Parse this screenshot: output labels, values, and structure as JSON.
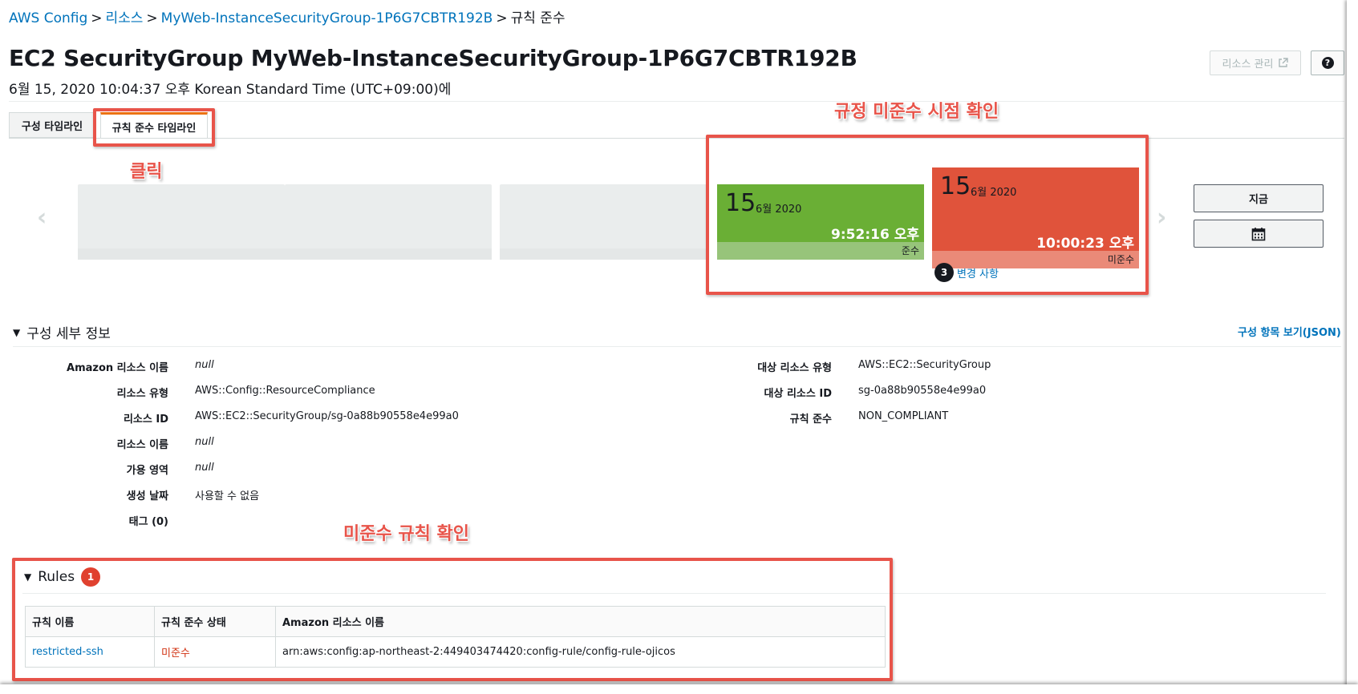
{
  "breadcrumb": {
    "items": [
      "AWS Config",
      "리소스",
      "MyWeb-InstanceSecurityGroup-1P6G7CBTR192B"
    ],
    "current": "규칙 준수",
    "separator": ">"
  },
  "header": {
    "title": "EC2 SecurityGroup MyWeb-InstanceSecurityGroup-1P6G7CBTR192B",
    "subtitle": "6월 15, 2020 10:04:37 오후 Korean Standard Time (UTC+09:00)에",
    "manage_button": "리소스 관리",
    "help_button": "?"
  },
  "tabs": [
    {
      "label": "구성 타임라인"
    },
    {
      "label": "규칙 준수 타임라인"
    }
  ],
  "annotations": {
    "click": "클릭",
    "timeline": "규정 미준수 시점 확인",
    "rules": "미준수 규칙 확인"
  },
  "timeline": {
    "cards": [
      {
        "day": "15",
        "month": "6월 2020",
        "time": "9:52:16 오후",
        "status": "준수",
        "color": "#6aaf35"
      },
      {
        "day": "15",
        "month": "6월 2020",
        "time": "10:00:23 오후",
        "status": "미준수",
        "color": "#e0533b"
      }
    ],
    "changes_count": "3",
    "changes_label": "변경 사항",
    "now_button": "지금",
    "calendar_icon": "calendar-icon"
  },
  "config_details": {
    "title": "구성 세부 정보",
    "json_link": "구성 항목 보기(JSON)",
    "left": [
      {
        "label": "Amazon 리소스 이름",
        "value": "null"
      },
      {
        "label": "리소스 유형",
        "value": "AWS::Config::ResourceCompliance"
      },
      {
        "label": "리소스 ID",
        "value": "AWS::EC2::SecurityGroup/sg-0a88b90558e4e99a0"
      },
      {
        "label": "리소스 이름",
        "value": "null"
      },
      {
        "label": "가용 영역",
        "value": "null"
      },
      {
        "label": "생성 날짜",
        "value": "사용할 수 없음"
      },
      {
        "label": "태그 (0)",
        "value": ""
      }
    ],
    "right": [
      {
        "label": "대상 리소스 유형",
        "value": "AWS::EC2::SecurityGroup"
      },
      {
        "label": "대상 리소스 ID",
        "value": "sg-0a88b90558e4e99a0"
      },
      {
        "label": "규칙 준수",
        "value": "NON_COMPLIANT"
      }
    ]
  },
  "rules": {
    "title": "Rules",
    "count": "1",
    "columns": [
      "규칙 이름",
      "규칙 준수 상태",
      "Amazon 리소스 이름"
    ],
    "rows": [
      {
        "name": "restricted-ssh",
        "status": "미준수",
        "arn": "arn:aws:config:ap-northeast-2:449403474420:config-rule/config-rule-ojicos"
      }
    ]
  },
  "colors": {
    "link": "#0073bb",
    "highlight": "#e8544a",
    "compliant": "#6aaf35",
    "noncompliant": "#e0533b"
  }
}
